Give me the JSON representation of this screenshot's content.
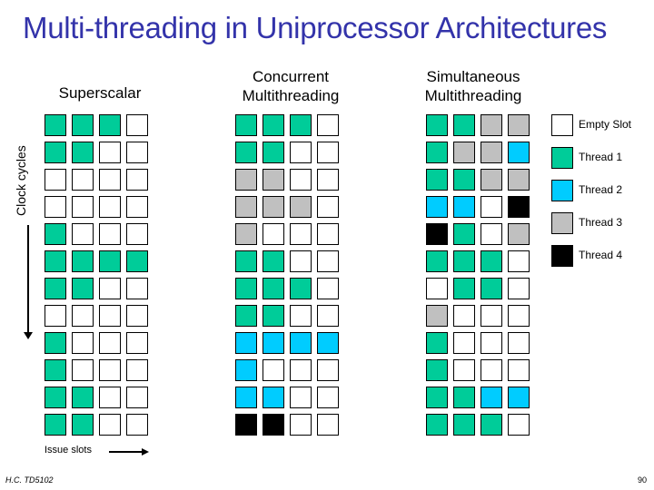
{
  "title": "Multi-threading in Uniprocessor Architectures",
  "colors": {
    "E": "#ffffff",
    "G": "#00cc99",
    "B": "#00ccff",
    "R": "#c0c0c0",
    "K": "#000000",
    "title": "#3333aa"
  },
  "columns": [
    {
      "heading": "Superscalar",
      "rows": [
        "GGGE",
        "GGEE",
        "EEEE",
        "EEEE",
        "GEEE",
        "GGGG",
        "GGEE",
        "EEEE",
        "GEEE",
        "GEEE",
        "GGEE",
        "GGEE"
      ]
    },
    {
      "heading": "Concurrent Multithreading",
      "heading_line1": "Concurrent",
      "heading_line2": "Multithreading",
      "rows": [
        "GGGE",
        "GGEE",
        "RREE",
        "RRRE",
        "REEE",
        "GGEE",
        "GGGE",
        "GGEE",
        "BBBB",
        "BEEE",
        "BBEE",
        "KKEE"
      ]
    },
    {
      "heading": "Simultaneous Multithreading",
      "heading_line1": "Simultaneous",
      "heading_line2": "Multithreading",
      "rows": [
        "GGRR",
        "GRRB",
        "GGRR",
        "BBEK",
        "KGER",
        "GGGE",
        "EGGE",
        "REEE",
        "GEEE",
        "GEEE",
        "GGBB",
        "GGGE"
      ]
    }
  ],
  "legend": [
    {
      "key": "E",
      "label": "Empty Slot"
    },
    {
      "key": "G",
      "label": "Thread 1"
    },
    {
      "key": "B",
      "label": "Thread 2"
    },
    {
      "key": "R",
      "label": "Thread 3"
    },
    {
      "key": "K",
      "label": "Thread 4"
    }
  ],
  "axis": {
    "y_label": "Clock cycles",
    "x_label": "Issue slots"
  },
  "footer": {
    "left": "H.C.  TD5102",
    "right": "90"
  }
}
